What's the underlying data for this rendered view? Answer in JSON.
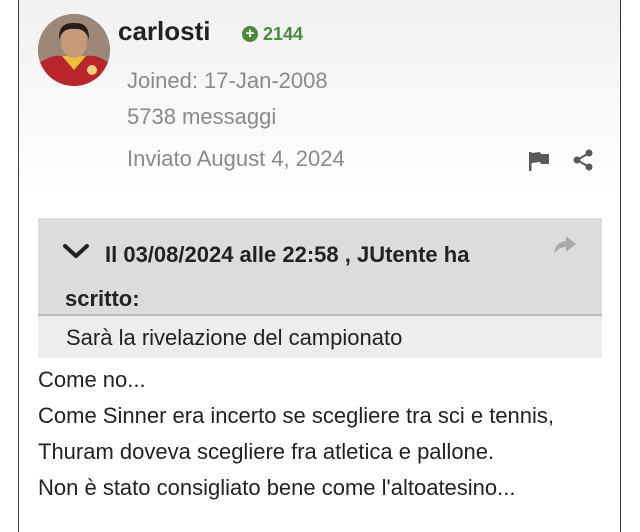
{
  "author": {
    "name": "carlosti",
    "reputation": "2144",
    "reputation_icon": "plus-circle-icon",
    "joined": "Joined: 17-Jan-2008",
    "posts_count": "5738 messaggi"
  },
  "post": {
    "posted": "Inviato August 4, 2024",
    "actions": [
      "flag-icon",
      "share-icon"
    ]
  },
  "quote": {
    "header": "Il 03/08/2024 alle 22:58 , JUtente ha scritto:",
    "text": "Sarà la rivelazione del campionato"
  },
  "body": {
    "lines": [
      "Come no...",
      "Come Sinner era incerto se scegliere tra sci e tennis,",
      "Thuram doveva scegliere fra atletica e pallone.",
      "Non è stato consigliato bene come l'altoatesino..."
    ]
  },
  "colors": {
    "reputation_green": "#4a8a3a",
    "meta_gray": "#8a8a8a",
    "quote_header_bg": "#dcdcdc",
    "quote_body_bg": "#ededed"
  }
}
